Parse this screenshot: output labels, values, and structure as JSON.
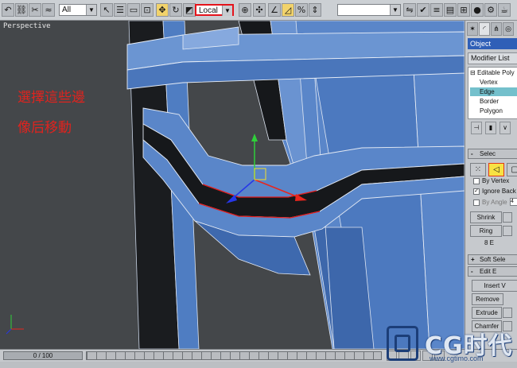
{
  "toolbar": {
    "filter_value": "All",
    "ref_coord_value": "Local",
    "named_sel_value": "",
    "ref_coord_highlight": "#e4131b"
  },
  "viewport": {
    "label": "Perspective",
    "annotation_lines": [
      "選擇這些邊",
      "像后移動"
    ],
    "annotation_color": "#e0231e"
  },
  "command_panel": {
    "object_name": "Object",
    "modifier_list": "Modifier List",
    "stack": [
      {
        "label": "Editable Poly",
        "level": 0,
        "selected": false
      },
      {
        "label": "Vertex",
        "level": 1,
        "selected": false
      },
      {
        "label": "Edge",
        "level": 1,
        "selected": true
      },
      {
        "label": "Border",
        "level": 1,
        "selected": false
      },
      {
        "label": "Polygon",
        "level": 1,
        "selected": false
      }
    ],
    "selection_rollout": "Selec",
    "by_vertex": "By Vertex",
    "ignore_back": "Ignore Back",
    "by_angle": "By Angle",
    "by_angle_value": "4",
    "shrink": "Shrink",
    "ring": "Ring",
    "sel_count": "8 E",
    "soft_sel_rollout": "Soft Sele",
    "edit_edges_rollout": "Edit E",
    "insert_vertex": "Insert V",
    "remove": "Remove",
    "extrude": "Extrude",
    "chamfer": "Chamfer"
  },
  "timeline": {
    "frame_readout": "0 / 100"
  },
  "watermark": {
    "text": "CG时代",
    "url": "www.cgtimo.com"
  },
  "colors": {
    "mesh_blue": "#5a86c9",
    "mesh_dark": "#17191c",
    "selected_edge": "#e11b1b",
    "viewport_bg": "#44474a",
    "stack_selected": "#74c0cc"
  }
}
